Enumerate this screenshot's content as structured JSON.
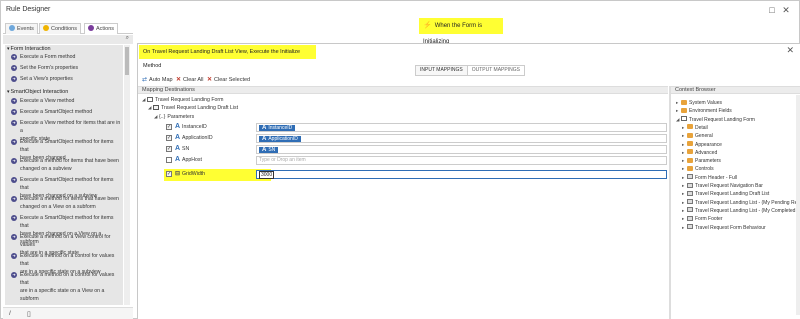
{
  "window": {
    "title": "Rule Designer",
    "banner": "When the Form is Initializing"
  },
  "left_tabs": [
    {
      "label": "Events",
      "color": "#6fa8dc"
    },
    {
      "label": "Conditions",
      "color": "#f0b400"
    },
    {
      "label": "Actions",
      "color": "#7a3d9c"
    }
  ],
  "categories": {
    "form": "Form Interaction",
    "smartobject": "SmartObject Interaction"
  },
  "form_actions": [
    "Execute a Form method",
    "Set the Form's properties",
    "Set a View's properties"
  ],
  "smartobject_actions": [
    "Execute a View method",
    "Execute a SmartObject method",
    "Execute a View method for items that are in a",
    "specific state",
    "Execute a SmartObject method for items that",
    "have been changed",
    "Execute a method for items that have been",
    "changed on a subview",
    "Execute a SmartObject method for items that",
    "have been changed on a subview",
    "Execute a method for items that have been",
    "changed on a View on a subform",
    "Execute a SmartObject method for items that",
    "have been changed on a View on a subform",
    "Execute a method on a View control for values",
    "that are in a specific state",
    "Execute a method on a control for values that",
    "are in a specific state on a subview",
    "Execute a method on a control for values that",
    "are in a specific state on a View on a subform"
  ],
  "dialog": {
    "title": "On Travel Request Landing Draft List View, Execute the Initialize Method",
    "tabs": [
      "INPUT MAPPINGS",
      "OUTPUT MAPPINGS"
    ],
    "toolbar": {
      "auto_map": "Auto Map",
      "clear_all": "Clear All",
      "clear_selected": "Clear Selected"
    },
    "mapping_header": "Mapping Destinations",
    "browser_header": "Context Browser",
    "tree": {
      "form": "Travel Request Landing Form",
      "view": "Travel Request Landing Draft List",
      "params": "Parameters"
    },
    "params": [
      {
        "name": "InstanceID",
        "value": "InstanceID",
        "checked": true
      },
      {
        "name": "ApplicationID",
        "value": "ApplicationID",
        "checked": true
      },
      {
        "name": "SN",
        "value": "SN",
        "checked": true
      },
      {
        "name": "AppHost",
        "placeholder": "Type or Drop an item",
        "checked": false
      },
      {
        "name": "GridWidth",
        "value": "3000",
        "checked": true
      }
    ],
    "context_browser": [
      {
        "label": "System Values",
        "level": 0,
        "icon": "folder"
      },
      {
        "label": "Environment Fields",
        "level": 0,
        "icon": "folder"
      },
      {
        "label": "Travel Request Landing Form",
        "level": 0,
        "icon": "form",
        "expanded": true
      },
      {
        "label": "Detail",
        "level": 1,
        "icon": "folder"
      },
      {
        "label": "General",
        "level": 1,
        "icon": "folder"
      },
      {
        "label": "Appearance",
        "level": 1,
        "icon": "folder"
      },
      {
        "label": "Advanced",
        "level": 1,
        "icon": "folder"
      },
      {
        "label": "Parameters",
        "level": 1,
        "icon": "folder"
      },
      {
        "label": "Controls",
        "level": 1,
        "icon": "folder"
      },
      {
        "label": "Form Header - Full",
        "level": 1,
        "icon": "ctrl"
      },
      {
        "label": "Travel Request Navigation Bar",
        "level": 1,
        "icon": "ctrl"
      },
      {
        "label": "Travel Request Landing Draft List",
        "level": 1,
        "icon": "ctrl"
      },
      {
        "label": "Travel Request Landing List - (My Pending Req",
        "level": 1,
        "icon": "ctrl"
      },
      {
        "label": "Travel Request Landing List - (My Completed R",
        "level": 1,
        "icon": "ctrl"
      },
      {
        "label": "Form Footer",
        "level": 1,
        "icon": "ctrl"
      },
      {
        "label": "Travel Request Form Behaviour",
        "level": 1,
        "icon": "ctrl"
      }
    ]
  }
}
